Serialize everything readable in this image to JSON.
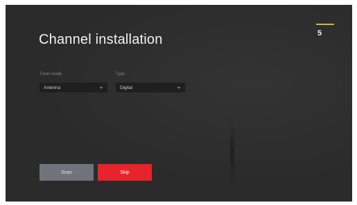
{
  "page": {
    "title": "Channel installation",
    "step": "5"
  },
  "fields": {
    "tuner_mode": {
      "label": "Tuner mode",
      "value": "Antenna"
    },
    "type": {
      "label": "Type",
      "value": "Digital"
    }
  },
  "buttons": {
    "scan_label": "Scan",
    "skip_label": "Skip"
  },
  "icons": {
    "dropdown": "chevron-down-icon"
  },
  "colors": {
    "background": "#2b2b2b",
    "accent": "#e8232a",
    "step_bar": "#c9b84a",
    "secondary_button": "#70737a"
  }
}
